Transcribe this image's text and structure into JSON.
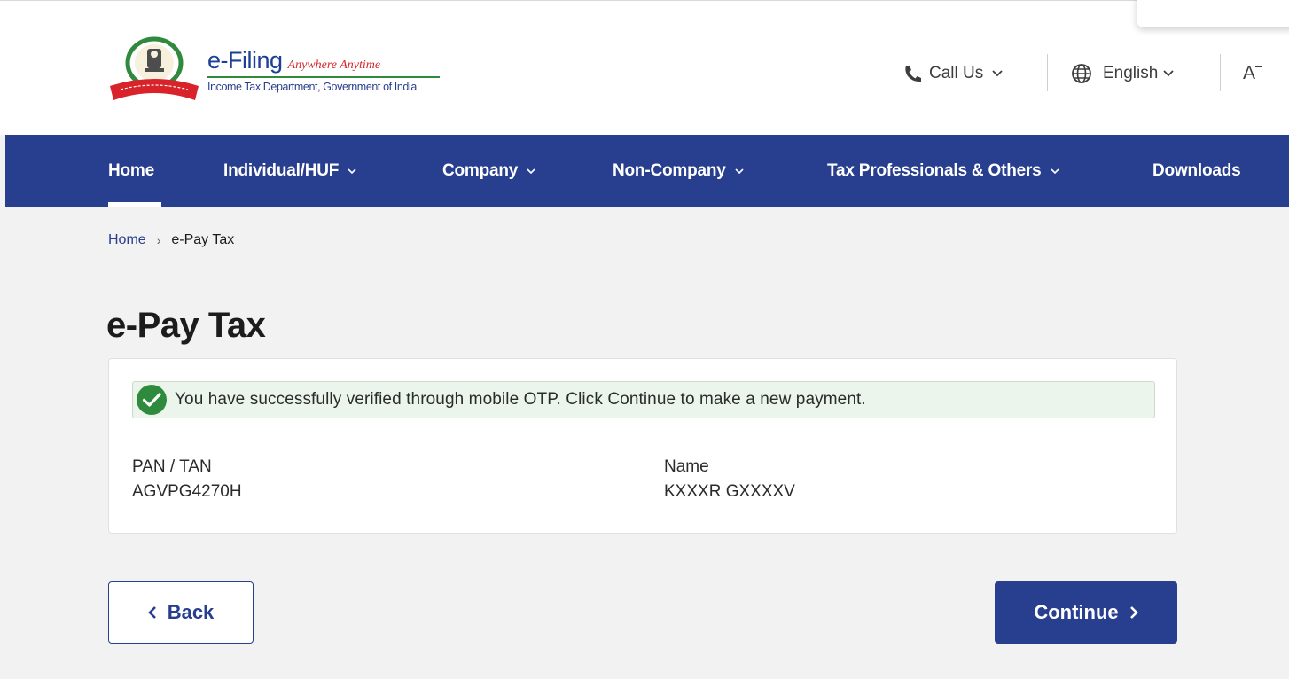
{
  "header": {
    "brand_name": "e-Filing",
    "brand_tagline": "Anywhere Anytime",
    "brand_subtitle": "Income Tax Department, Government of India",
    "call_us_label": "Call Us",
    "language_label": "English",
    "font_size_label": "A"
  },
  "nav": {
    "items": [
      {
        "label": "Home"
      },
      {
        "label": "Individual/HUF"
      },
      {
        "label": "Company"
      },
      {
        "label": "Non-Company"
      },
      {
        "label": "Tax Professionals & Others"
      },
      {
        "label": "Downloads"
      }
    ]
  },
  "breadcrumb": {
    "home": "Home",
    "current": "e-Pay Tax"
  },
  "page": {
    "title": "e-Pay Tax"
  },
  "alert": {
    "message": "You have successfully verified through mobile OTP. Click Continue to make a new payment."
  },
  "details": {
    "pan_label": "PAN / TAN",
    "pan_value": "AGVPG4270H",
    "name_label": "Name",
    "name_value": "KXXXR GXXXXV"
  },
  "actions": {
    "back_label": "Back",
    "continue_label": "Continue"
  },
  "colors": {
    "primary": "#283e8f",
    "success": "#2e8b3e",
    "alert_bg": "#ebf5eb",
    "background": "#f2f2f2"
  }
}
